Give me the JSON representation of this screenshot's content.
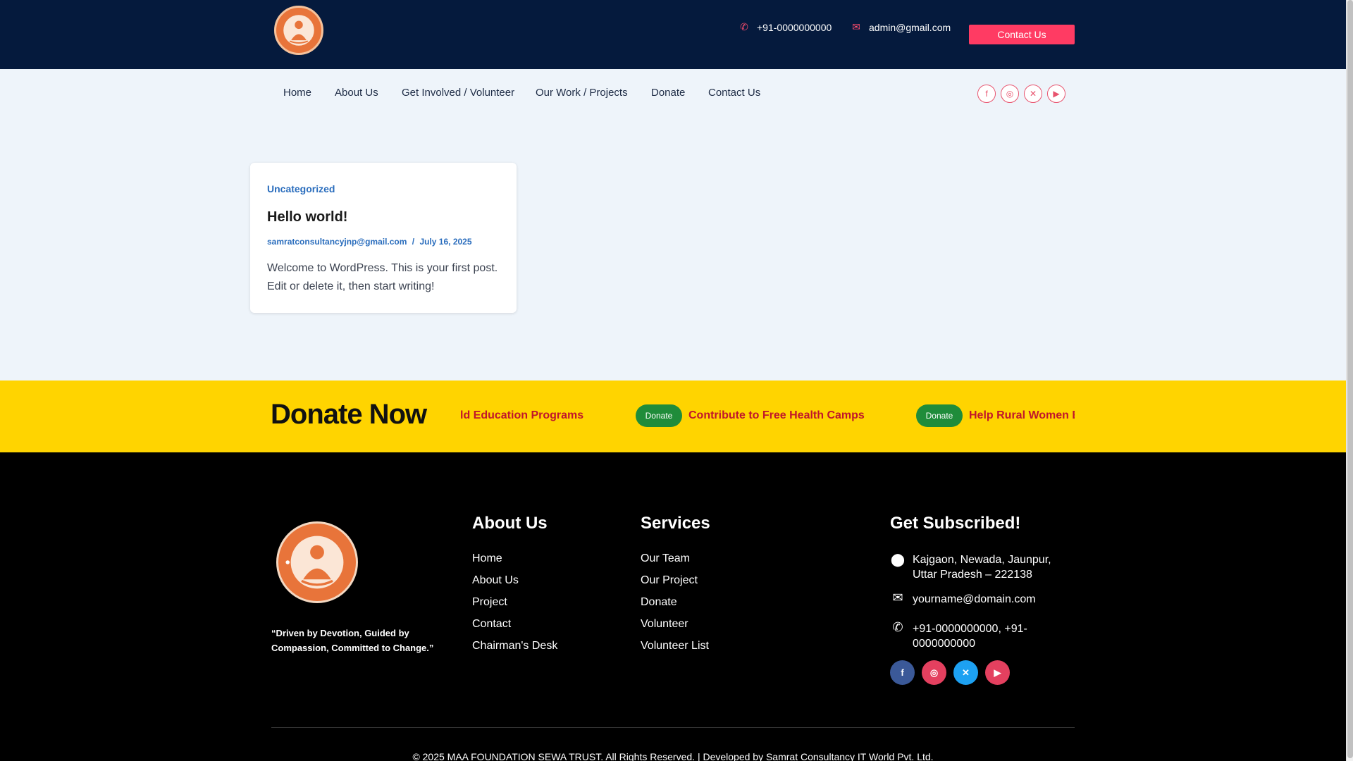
{
  "header": {
    "phone": "+91-0000000000",
    "email": "admin@gmail.com",
    "contact_button": "Contact Us"
  },
  "nav": {
    "items": [
      "Home",
      "About Us",
      "Get Involved / Volunteer",
      "Our Work / Projects",
      "Donate",
      "Contact Us"
    ],
    "social_icons": [
      "facebook-icon",
      "instagram-icon",
      "x-icon",
      "youtube-icon"
    ]
  },
  "post": {
    "category": "Uncategorized",
    "title": "Hello world!",
    "author": "samratconsultancyjnp@gmail.com",
    "separator": "/",
    "date": "July 16, 2025",
    "excerpt": "Welcome to WordPress. This is your first post. Edit or delete it, then start writing!"
  },
  "donate": {
    "title": "Donate Now",
    "ticker": [
      {
        "text": "ld Education Programs"
      },
      {
        "badge": "Donate",
        "text": "Contribute to Free Health Camps"
      },
      {
        "badge": "Donate",
        "text": "Help Rural Women E"
      }
    ]
  },
  "footer": {
    "tagline": "“Driven by Devotion, Guided by Compassion, Committed to Change.”",
    "about": {
      "heading": "About Us",
      "links": [
        "Home",
        "About Us",
        "Project",
        "Contact",
        "Chairman's Desk"
      ]
    },
    "services": {
      "heading": "Services",
      "links": [
        "Our Team",
        "Our Project",
        "Donate",
        "Volunteer",
        "Volunteer List"
      ]
    },
    "subscribe": {
      "heading": "Get Subscribed!",
      "address": "Kajgaon, Newada, Jaunpur, Uttar Pradesh – 222138",
      "email": "yourname@domain.com",
      "phones": "+91-0000000000, +91-0000000000"
    },
    "social_icons": [
      "facebook-icon",
      "instagram-icon",
      "x-icon",
      "youtube-icon"
    ],
    "copyright": "© 2025 MAA FOUNDATION SEWA TRUST. All Rights Reserved. | Developed by Samrat Consultancy IT World Pvt. Ltd."
  },
  "colors": {
    "topbar": "#051a3d",
    "accent": "#ff3b63",
    "donate_strip": "#ffd400",
    "ticker_text": "#c0162b",
    "badge": "#1f8c3a",
    "link_blue": "#2a6dbd"
  }
}
